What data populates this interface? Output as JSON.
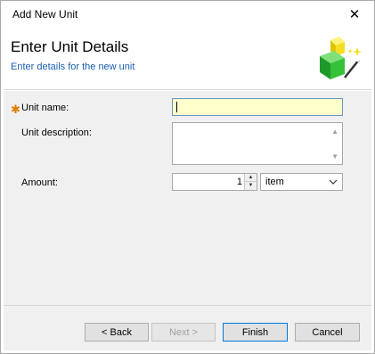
{
  "window": {
    "title": "Add New Unit",
    "close_symbol": "✕"
  },
  "header": {
    "title": "Enter Unit Details",
    "subtitle": "Enter details for the new unit",
    "icon": "wizard-cubes-icon"
  },
  "form": {
    "required_marker": "✱",
    "unit_name_label": "Unit name:",
    "unit_name_value": "",
    "unit_description_label": "Unit description:",
    "unit_description_value": "",
    "amount_label": "Amount:",
    "amount_value": "1",
    "unit_type_value": "item"
  },
  "buttons": {
    "back": "< Back",
    "next": "Next >",
    "finish": "Finish",
    "cancel": "Cancel"
  },
  "colors": {
    "required_star": "#e07b00",
    "subtitle": "#1b5fb3",
    "name_input_bg": "#ffffcc",
    "focus_border": "#0078d7"
  }
}
